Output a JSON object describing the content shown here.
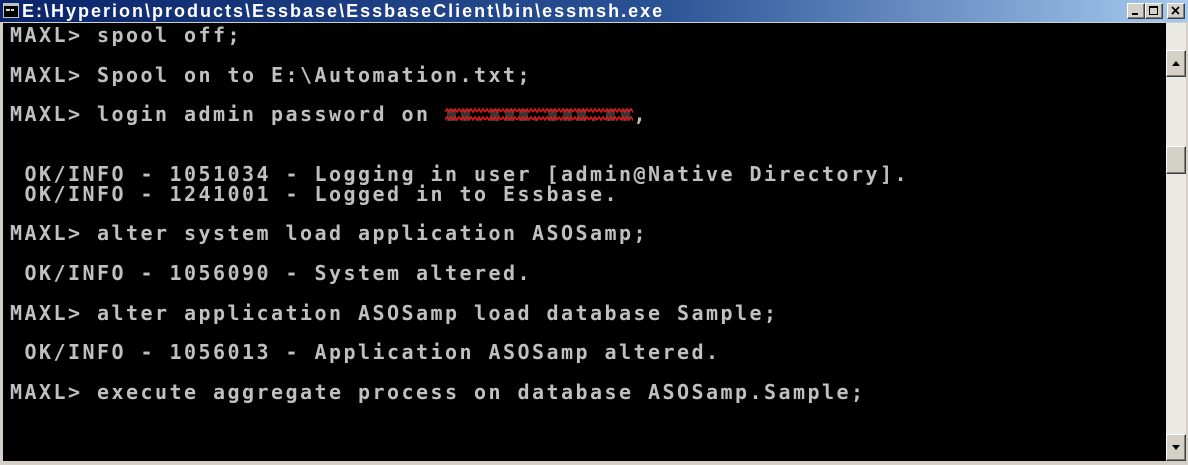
{
  "window": {
    "title": "E:\\Hyperion\\products\\Essbase\\EssbaseClient\\bin\\essmsh.exe",
    "icon": "console-app-icon",
    "controls": [
      "minimize-icon",
      "maximize-icon",
      "close-icon"
    ]
  },
  "theme": {
    "titlebar_start": "#0a246a",
    "titlebar_end": "#a6caf0",
    "console_background": "#000000",
    "console_text": "#c0c0c0",
    "redaction_mark": "#d41a1a",
    "chrome": "#d4d0c8"
  },
  "console": {
    "lines": [
      "MAXL> spool off;",
      "",
      "MAXL> Spool on to E:\\Automation.txt;",
      "",
      {
        "before": "MAXL> login admin password on ",
        "after": ","
      },
      "",
      "",
      " OK/INFO - 1051034 - Logging in user [admin@Native Directory].",
      " OK/INFO - 1241001 - Logged in to Essbase.",
      "",
      "MAXL> alter system load application ASOSamp;",
      "",
      " OK/INFO - 1056090 - System altered.",
      "",
      "MAXL> alter application ASOSamp load database Sample;",
      "",
      " OK/INFO - 1056013 - Application ASOSamp altered.",
      "",
      "MAXL> execute aggregate process on database ASOSamp.Sample;"
    ]
  },
  "scrollbar": {
    "position_fraction": 0.21,
    "up_icon": "up-arrow-icon",
    "down_icon": "down-arrow-icon"
  }
}
